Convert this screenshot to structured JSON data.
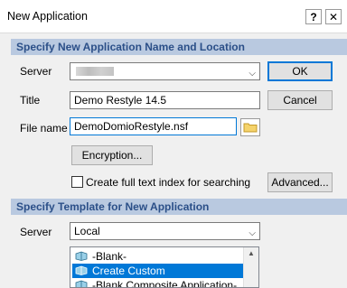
{
  "window": {
    "title": "New Application"
  },
  "titlebar_buttons": {
    "help": "?",
    "close": "✕"
  },
  "section1": {
    "heading": "Specify New Application Name and Location",
    "server_label": "Server",
    "title_label": "Title",
    "title_value": "Demo Restyle 14.5",
    "filename_label": "File name",
    "filename_value": "DemoDomioRestyle.nsf",
    "encryption_label": "Encryption...",
    "fulltext_label": "Create full text index for searching",
    "fulltext_checked": false
  },
  "buttons": {
    "ok": "OK",
    "cancel": "Cancel",
    "advanced": "Advanced..."
  },
  "section2": {
    "heading": "Specify Template for New Application",
    "server_label": "Server",
    "server_value": "Local",
    "templates": [
      {
        "label": "-Blank-",
        "selected": false
      },
      {
        "label": "Create Custom",
        "selected": true
      },
      {
        "label": "-Blank Composite Application-",
        "selected": false
      }
    ]
  },
  "colors": {
    "section_bg": "#b9c9e0",
    "section_text": "#2b4f88",
    "selection": "#0078d7"
  }
}
